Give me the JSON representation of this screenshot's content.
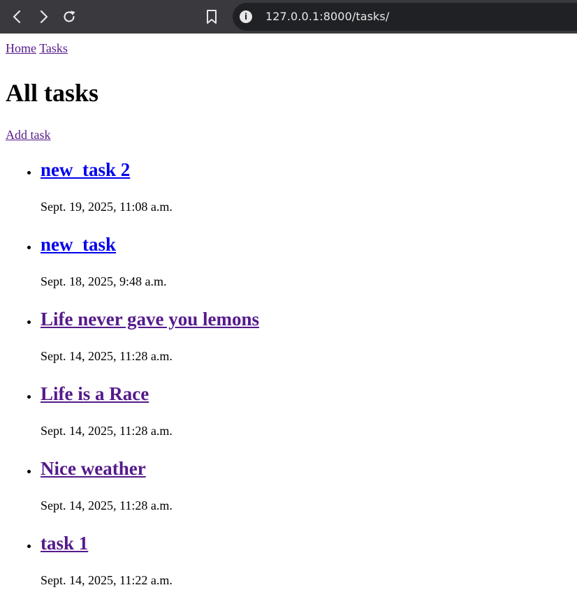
{
  "browser": {
    "url": "127.0.0.1:8000/tasks/"
  },
  "breadcrumb": {
    "home": "Home",
    "tasks": "Tasks"
  },
  "page": {
    "title": "All tasks",
    "add_task": "Add task"
  },
  "tasks": [
    {
      "title": "new_task 2",
      "date": "Sept. 19, 2025, 11:08 a.m.",
      "visited": false
    },
    {
      "title": "new_task",
      "date": "Sept. 18, 2025, 9:48 a.m.",
      "visited": false
    },
    {
      "title": "Life never gave you lemons",
      "date": "Sept. 14, 2025, 11:28 a.m.",
      "visited": true
    },
    {
      "title": "Life is a Race",
      "date": "Sept. 14, 2025, 11:28 a.m.",
      "visited": true
    },
    {
      "title": "Nice weather",
      "date": "Sept. 14, 2025, 11:28 a.m.",
      "visited": true
    },
    {
      "title": "task 1",
      "date": "Sept. 14, 2025, 11:22 a.m.",
      "visited": true
    }
  ],
  "colors": {
    "link_unvisited": "#0000ee",
    "link_visited": "#551a8b",
    "chrome_bg": "#3a3a3e",
    "urlbar_bg": "#202124"
  }
}
